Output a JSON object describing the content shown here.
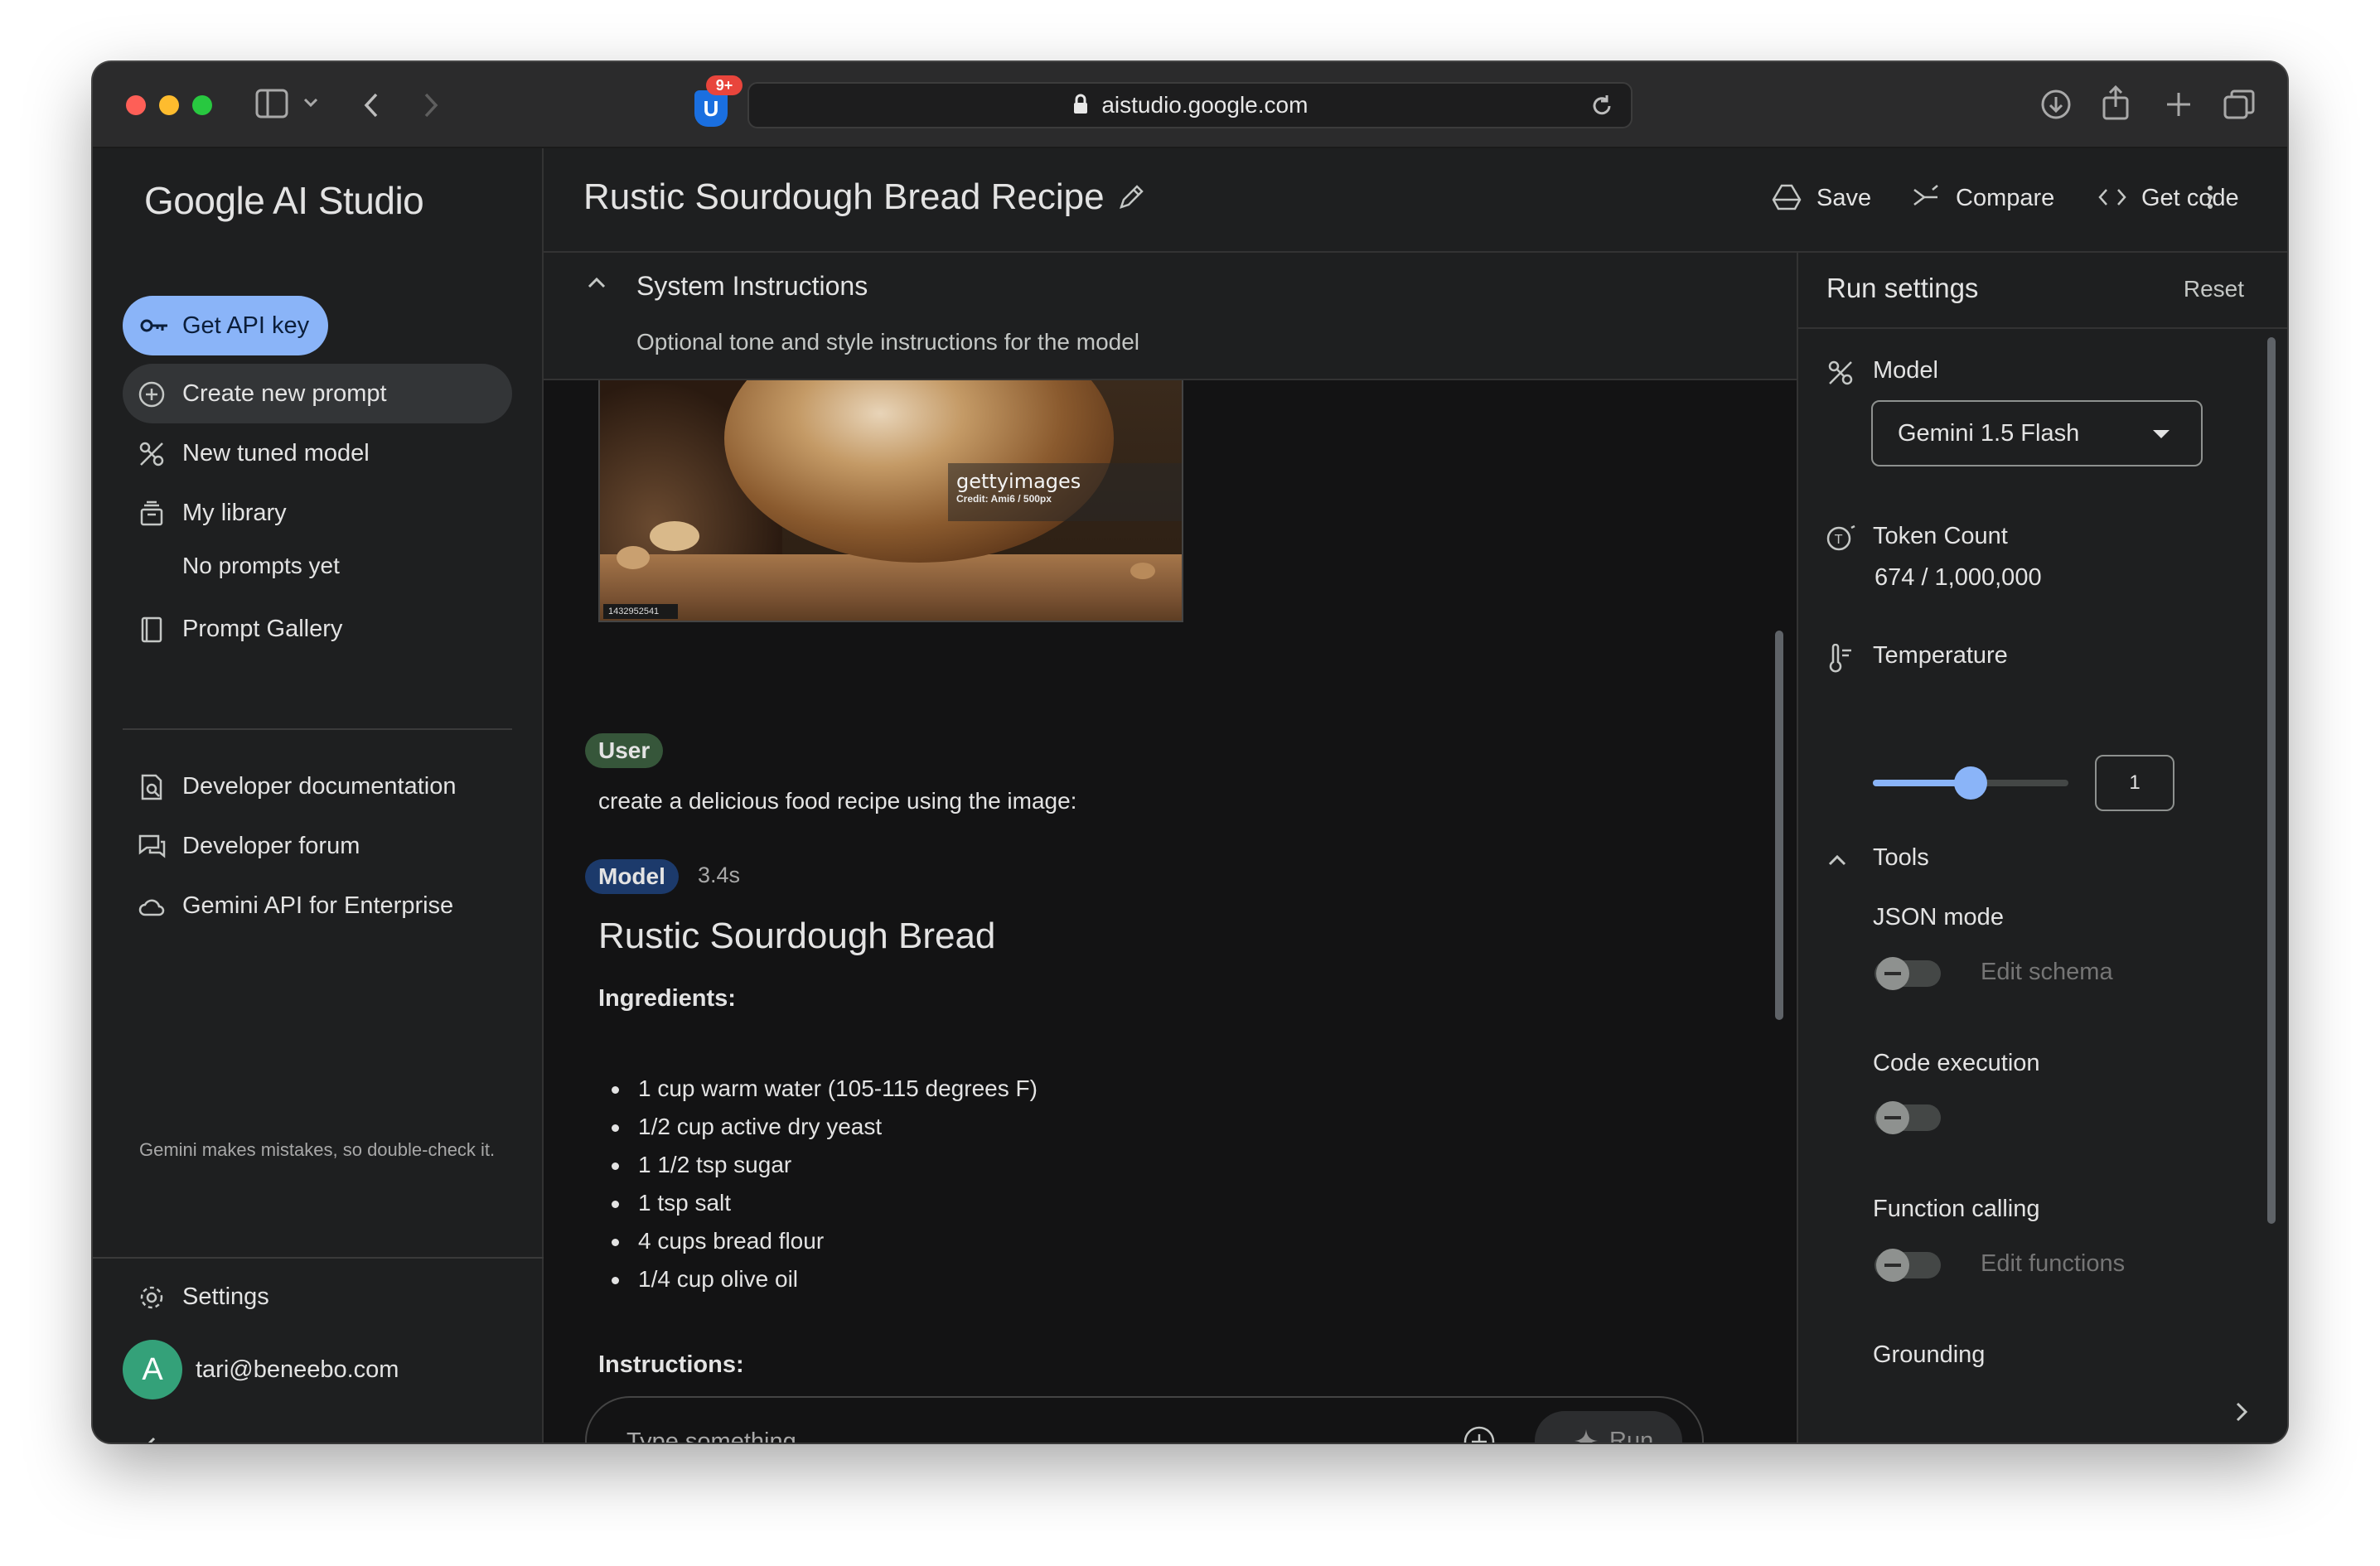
{
  "browser": {
    "url": "aistudio.google.com",
    "extension_badge": "9+",
    "extension_letter": "U"
  },
  "sidebar": {
    "brand": "Google AI Studio",
    "api_button": "Get API key",
    "items": [
      {
        "label": "Create new prompt",
        "icon": "plus-circle-icon"
      },
      {
        "label": "New tuned model",
        "icon": "tune-icon"
      },
      {
        "label": "My library",
        "icon": "library-icon"
      },
      {
        "label": "Prompt Gallery",
        "icon": "book-icon"
      }
    ],
    "library_empty": "No prompts yet",
    "links": [
      {
        "label": "Developer documentation",
        "icon": "doc-search-icon"
      },
      {
        "label": "Developer forum",
        "icon": "forum-icon"
      },
      {
        "label": "Gemini API for Enterprise",
        "icon": "cloud-icon"
      }
    ],
    "disclaimer": "Gemini makes mistakes, so double-check it.",
    "settings": "Settings",
    "user": {
      "initial": "A",
      "email": "tari@beneebo.com"
    }
  },
  "header": {
    "title": "Rustic Sourdough Bread Recipe",
    "save": "Save",
    "compare": "Compare",
    "get_code": "Get code"
  },
  "system_instructions": {
    "title": "System Instructions",
    "placeholder": "Optional tone and style instructions for the model"
  },
  "chat": {
    "image": {
      "watermark": "gettyimages",
      "credit": "Credit: Ami6 / 500px",
      "id": "1432952541"
    },
    "user_chip": "User",
    "user_message": "create a delicious food recipe using the image:",
    "model_chip": "Model",
    "latency": "3.4s",
    "response_title": "Rustic Sourdough Bread",
    "ingredients_heading": "Ingredients:",
    "ingredients": [
      "1 cup warm water (105-115 degrees F)",
      "1/2 cup active dry yeast",
      "1 1/2 tsp sugar",
      "1 tsp salt",
      "4 cups bread flour",
      "1/4 cup olive oil"
    ],
    "instructions_heading": "Instructions:"
  },
  "composer": {
    "placeholder": "Type something",
    "run": "Run"
  },
  "run_settings": {
    "title": "Run settings",
    "reset": "Reset",
    "model_label": "Model",
    "model_value": "Gemini 1.5 Flash",
    "token_label": "Token Count",
    "token_value": "674 / 1,000,000",
    "temperature_label": "Temperature",
    "temperature_value": "1",
    "temperature_fraction": 0.5,
    "tools_label": "Tools",
    "json_mode": "JSON mode",
    "edit_schema": "Edit schema",
    "code_execution": "Code execution",
    "function_calling": "Function calling",
    "edit_functions": "Edit functions",
    "grounding": "Grounding"
  },
  "colors": {
    "accent": "#8ab4f8",
    "background": "#131314",
    "panel": "#1e1f20",
    "user_chip": "#36563a",
    "model_chip": "#1c3a6b"
  }
}
